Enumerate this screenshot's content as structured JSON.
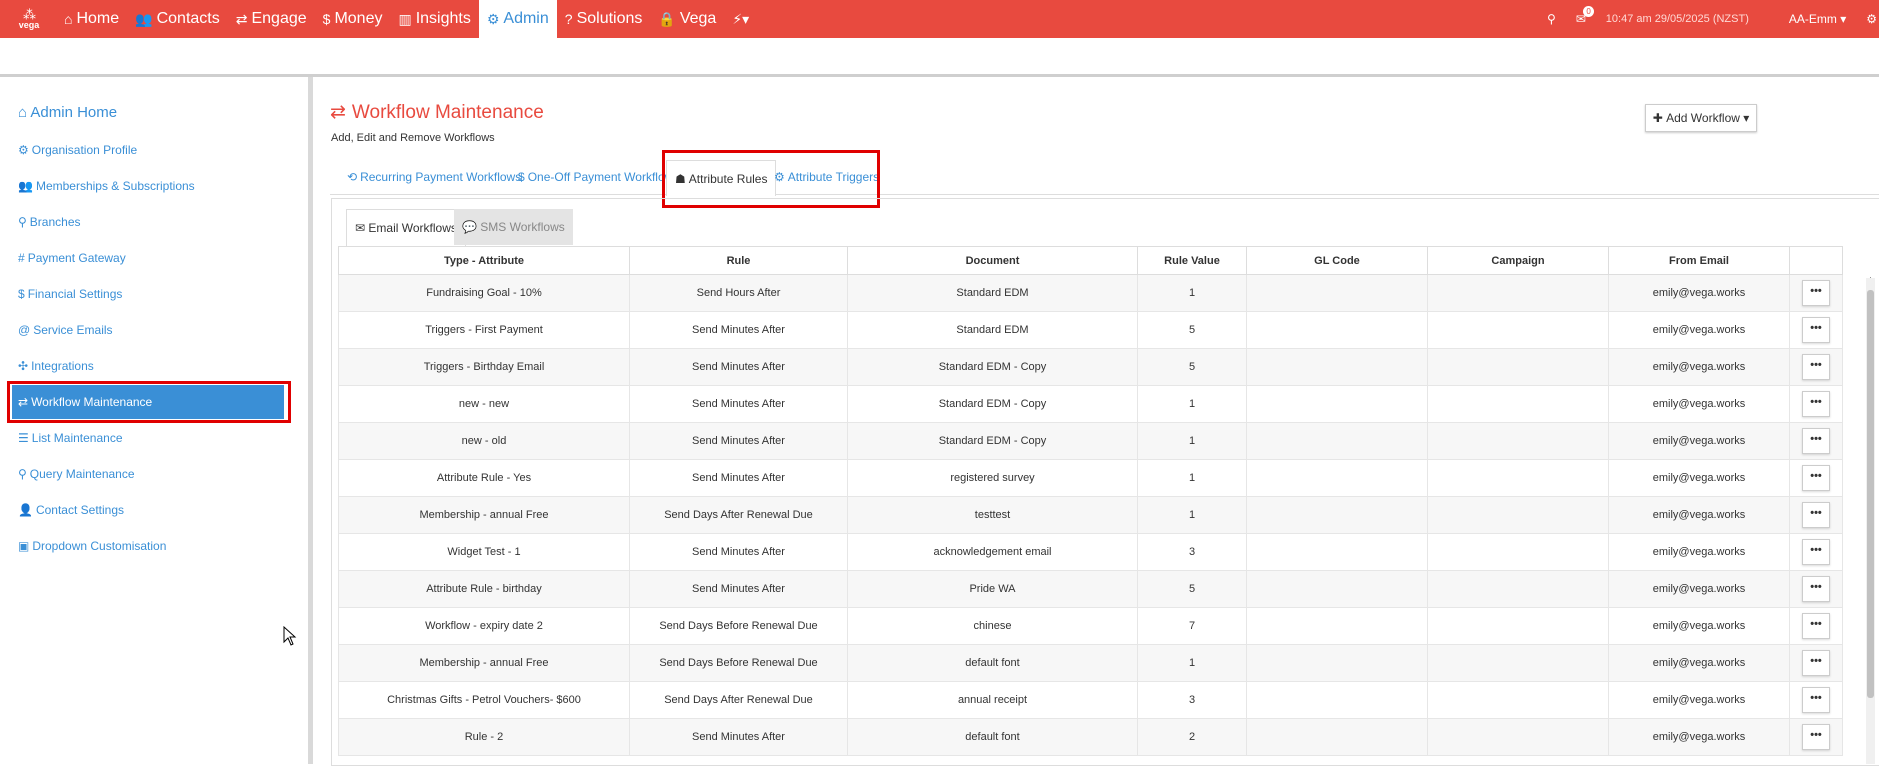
{
  "nav": {
    "logo_text": "vega",
    "items": [
      {
        "icon": "home-icon",
        "glyph": "⌂",
        "label": "Home"
      },
      {
        "icon": "contacts-icon",
        "glyph": "👥",
        "label": "Contacts"
      },
      {
        "icon": "engage-icon",
        "glyph": "⇄",
        "label": "Engage"
      },
      {
        "icon": "dollar-icon",
        "glyph": "$",
        "label": "Money"
      },
      {
        "icon": "bar-chart-icon",
        "glyph": "▥",
        "label": "Insights"
      },
      {
        "icon": "cogs-icon",
        "glyph": "⚙",
        "label": "Admin"
      },
      {
        "icon": "question-icon",
        "glyph": "?",
        "label": "Solutions"
      },
      {
        "icon": "lock-icon",
        "glyph": "🔒",
        "label": "Vega"
      },
      {
        "icon": "bolt-icon",
        "glyph": "⚡▾",
        "label": ""
      }
    ],
    "mail_badge": "0",
    "time": "10:47 am 29/05/2025 (NZST)",
    "user": "AA-Emm ▾"
  },
  "sidebar": {
    "title": "Admin Home",
    "items": [
      {
        "glyph": "⚙",
        "label": "Organisation Profile"
      },
      {
        "glyph": "👥",
        "label": "Memberships & Subscriptions"
      },
      {
        "glyph": "⚲",
        "label": "Branches"
      },
      {
        "glyph": "#",
        "label": "Payment Gateway"
      },
      {
        "glyph": "$",
        "label": "Financial Settings"
      },
      {
        "glyph": "@",
        "label": "Service Emails"
      },
      {
        "glyph": "✣",
        "label": "Integrations"
      },
      {
        "glyph": "⇄",
        "label": "Workflow Maintenance"
      },
      {
        "glyph": "☰",
        "label": "List Maintenance"
      },
      {
        "glyph": "⚲",
        "label": "Query Maintenance"
      },
      {
        "glyph": "👤",
        "label": "Contact Settings"
      },
      {
        "glyph": "▣",
        "label": "Dropdown Customisation"
      }
    ]
  },
  "main": {
    "title": "Workflow Maintenance",
    "subtitle": "Add, Edit and Remove Workflows",
    "add_button": "Add Workflow",
    "tabs": [
      {
        "glyph": "⟲",
        "label": "Recurring Payment Workflows"
      },
      {
        "glyph": "$",
        "label": "One-Off Payment Workflows"
      },
      {
        "glyph": "☗",
        "label": "Attribute Rules"
      },
      {
        "glyph": "⚙",
        "label": "Attribute Triggers"
      }
    ],
    "subtabs": [
      {
        "glyph": "✉",
        "label": "Email Workflows"
      },
      {
        "glyph": "💬",
        "label": "SMS Workflows"
      }
    ]
  },
  "table": {
    "columns": [
      "Type - Attribute",
      "Rule",
      "Document",
      "Rule Value",
      "GL Code",
      "Campaign",
      "From Email",
      ""
    ],
    "rows": [
      [
        "Fundraising Goal - 10%",
        "Send Hours After",
        "Standard EDM",
        "1",
        "",
        "",
        "emily@vega.works"
      ],
      [
        "Triggers - First Payment",
        "Send Minutes After",
        "Standard EDM",
        "5",
        "",
        "",
        "emily@vega.works"
      ],
      [
        "Triggers - Birthday Email",
        "Send Minutes After",
        "Standard EDM - Copy",
        "5",
        "",
        "",
        "emily@vega.works"
      ],
      [
        "new - new",
        "Send Minutes After",
        "Standard EDM - Copy",
        "1",
        "",
        "",
        "emily@vega.works"
      ],
      [
        "new - old",
        "Send Minutes After",
        "Standard EDM - Copy",
        "1",
        "",
        "",
        "emily@vega.works"
      ],
      [
        "Attribute Rule - Yes",
        "Send Minutes After",
        "registered survey",
        "1",
        "",
        "",
        "emily@vega.works"
      ],
      [
        "Membership - annual Free",
        "Send Days After Renewal Due",
        "testtest",
        "1",
        "",
        "",
        "emily@vega.works"
      ],
      [
        "Widget Test - 1",
        "Send Minutes After",
        "acknowledgement email",
        "3",
        "",
        "",
        "emily@vega.works"
      ],
      [
        "Attribute Rule - birthday",
        "Send Minutes After",
        "Pride WA",
        "5",
        "",
        "",
        "emily@vega.works"
      ],
      [
        "Workflow - expiry date 2",
        "Send Days Before Renewal Due",
        "chinese",
        "7",
        "",
        "",
        "emily@vega.works"
      ],
      [
        "Membership - annual Free",
        "Send Days Before Renewal Due",
        "default font",
        "1",
        "",
        "",
        "emily@vega.works"
      ],
      [
        "Christmas Gifts - Petrol Vouchers- $600",
        "Send Days After Renewal Due",
        "annual receipt",
        "3",
        "",
        "",
        "emily@vega.works"
      ],
      [
        "Rule - 2",
        "Send Minutes After",
        "default font",
        "2",
        "",
        "",
        "emily@vega.works"
      ]
    ],
    "action_label": "•••"
  }
}
